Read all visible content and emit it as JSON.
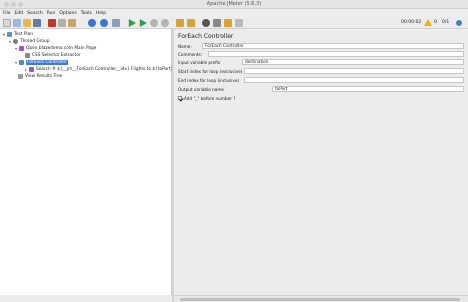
{
  "window": {
    "title": "Apache JMeter (5.6.3)"
  },
  "menu": [
    "File",
    "Edit",
    "Search",
    "Run",
    "Options",
    "Tools",
    "Help"
  ],
  "toolbar": {
    "icons": [
      "new-icon",
      "templates-icon",
      "open-icon",
      "save-icon",
      "cut-icon",
      "copy-icon",
      "paste-icon",
      "add-icon",
      "remove-icon",
      "toggle-icon",
      "start-icon",
      "start-no-pause-icon",
      "stop-icon",
      "shutdown-icon",
      "clear-icon",
      "clear-all-icon",
      "search-icon",
      "reset-search-icon",
      "function-helper-icon",
      "help-icon"
    ],
    "elapsed": "00:00:02",
    "warnings": "0",
    "threads": "0/1"
  },
  "tree": {
    "nodes": [
      {
        "label": "Test Plan",
        "depth": 0,
        "icon": "test-plan-icon",
        "color": "#6e8fb8"
      },
      {
        "label": "Thread Group",
        "depth": 1,
        "icon": "thread-group-icon",
        "color": "#7a7a7a"
      },
      {
        "label": "Open blazedemo.com Main Page",
        "depth": 2,
        "icon": "sampler-icon",
        "color": "#a64fd1"
      },
      {
        "label": "CSS Selector Extractor",
        "depth": 3,
        "icon": "extractor-icon",
        "color": "#888888"
      },
      {
        "label": "ForEach Controller",
        "depth": 2,
        "icon": "controller-icon",
        "color": "#5d86c0",
        "selected": true
      },
      {
        "label": "Search # ${__jm__ForEach Controller__idx} Flights to ${toPort}",
        "depth": 3,
        "icon": "sampler-icon",
        "color": "#a64fd1"
      },
      {
        "label": "View Results Tree",
        "depth": 2,
        "icon": "listener-icon",
        "color": "#999999"
      }
    ]
  },
  "editor": {
    "title": "ForEach Controller",
    "name_label": "Name:",
    "name_value": "ForEach Controller",
    "comments_label": "Comments:",
    "comments_value": "",
    "input_prefix_label": "Input variable prefix",
    "input_prefix_value": "destination",
    "start_index_label": "Start index for loop (exclusive)",
    "start_index_value": "",
    "end_index_label": "End index for loop (inclusive)",
    "end_index_value": "",
    "output_var_label": "Output variable name",
    "output_var_value": "toPort",
    "add_underscore_label": "Add \"_\" before number ?",
    "add_underscore_checked": true
  },
  "colors": {
    "selection": "#3d7bd6",
    "warning": "#f0b400",
    "start_green": "#2ea043"
  }
}
